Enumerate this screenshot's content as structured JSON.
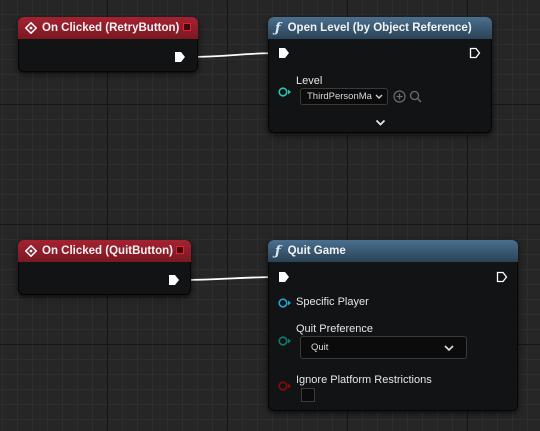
{
  "nodes": {
    "retry_event": {
      "title": "On Clicked (RetryButton)"
    },
    "open_level": {
      "title": "Open Level (by Object Reference)",
      "level_label": "Level",
      "level_value": "ThirdPersonMa"
    },
    "quit_event": {
      "title": "On Clicked (QuitButton)"
    },
    "quit_game": {
      "title": "Quit Game",
      "specific_player_label": "Specific Player",
      "quit_pref_label": "Quit Preference",
      "quit_pref_value": "Quit",
      "ignore_label": "Ignore Platform Restrictions"
    }
  },
  "colors": {
    "event_header": "#a52231",
    "function_header": "#4a6f8e",
    "exec_pin": "#ffffff",
    "object_pin": "#1fa6d8",
    "enum_pin": "#0f7b6c",
    "bool_pin": "#8b0b0b",
    "delegate_pin": "#e8202c"
  },
  "icons": {
    "event": "event-diamond-icon",
    "function": "function-f-icon",
    "expand": "chevron-down-icon",
    "browse": "plus-circle-icon",
    "search": "magnifier-icon"
  }
}
